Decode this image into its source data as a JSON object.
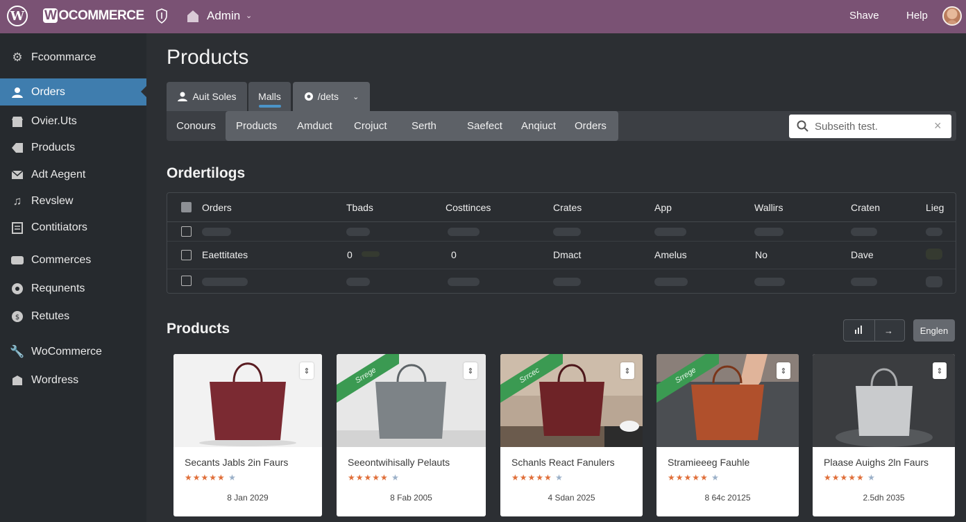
{
  "topbar": {
    "wp_logo_letter": "W",
    "brand_w": "W",
    "brand_rest": "OCOMMERCE",
    "admin_label": "Admin",
    "share_label": "Shave",
    "help_label": "Help"
  },
  "sidebar": {
    "items": [
      {
        "label": "Fcoommarce",
        "icon": "gear-icon"
      },
      {
        "label": "Orders",
        "icon": "user-icon",
        "active": true
      },
      {
        "label": "Ovier.Uts",
        "icon": "store-icon"
      },
      {
        "label": "Products",
        "icon": "tag-icon"
      },
      {
        "label": "Adt Aegent",
        "icon": "mail-icon"
      },
      {
        "label": "Revslew",
        "icon": "music-icon"
      },
      {
        "label": "Contitiators",
        "icon": "clipboard-icon"
      },
      {
        "label": "Commerces",
        "icon": "card-icon"
      },
      {
        "label": "Requnents",
        "icon": "circle-icon"
      },
      {
        "label": "Retutes",
        "icon": "badge-icon"
      },
      {
        "label": "WoCommerce",
        "icon": "wrench-icon"
      },
      {
        "label": "Wordress",
        "icon": "wordpress-icon"
      }
    ]
  },
  "main": {
    "page_title": "Products",
    "tabs": [
      {
        "label": "Auit Soles"
      },
      {
        "label": "Malls"
      },
      {
        "label": "/dets"
      }
    ],
    "subnav_first": "Conours",
    "subnav": [
      "Products",
      "Amduct",
      "Crojuct",
      "Serth",
      "Saefect",
      "Anqiuct",
      "Orders"
    ],
    "search": {
      "value": "",
      "placeholder": "Subseith test."
    },
    "orders_title": "Ordertilogs",
    "table": {
      "headers": [
        "Orders",
        "Tbads",
        "Costtinces",
        "Crates",
        "App",
        "Wallirs",
        "Craten",
        "Lieg"
      ],
      "row": {
        "name": "Eaettitates",
        "c2": "0",
        "c3": "0",
        "c4": "Dmact",
        "c5": "Amelus",
        "c6": "No",
        "c7": "Dave"
      }
    },
    "products_title": "Products",
    "engl_label": "Englen"
  },
  "products": [
    {
      "title": "Secants Jabls 2in Faurs",
      "rating": 5,
      "date": "8 Jan 2029",
      "ribbon": "",
      "bg": "studio-white",
      "bag_color": "#7b2a32"
    },
    {
      "title": "Seeontwihisally Pelauts",
      "rating": 5,
      "date": "8 Fab 2005",
      "ribbon": "Srrege",
      "bg": "studio-light",
      "bag_color": "#7d8387"
    },
    {
      "title": "Schanls React Fanulers",
      "rating": 5,
      "date": "4 Sdan 2025",
      "ribbon": "Srrcec",
      "bg": "interior",
      "bag_color": "#6e2327"
    },
    {
      "title": "Stramieeeg Fauhle",
      "rating": 5,
      "date": "8 64c 20125",
      "ribbon": "Srrege",
      "bg": "table",
      "bag_color": "#b0502c"
    },
    {
      "title": "Plaase Auighs 2ln Faurs",
      "rating": 5,
      "date": "2.5dh 2035",
      "ribbon": "",
      "bg": "studio-dark",
      "bag_color": "#c9cbcd"
    }
  ]
}
